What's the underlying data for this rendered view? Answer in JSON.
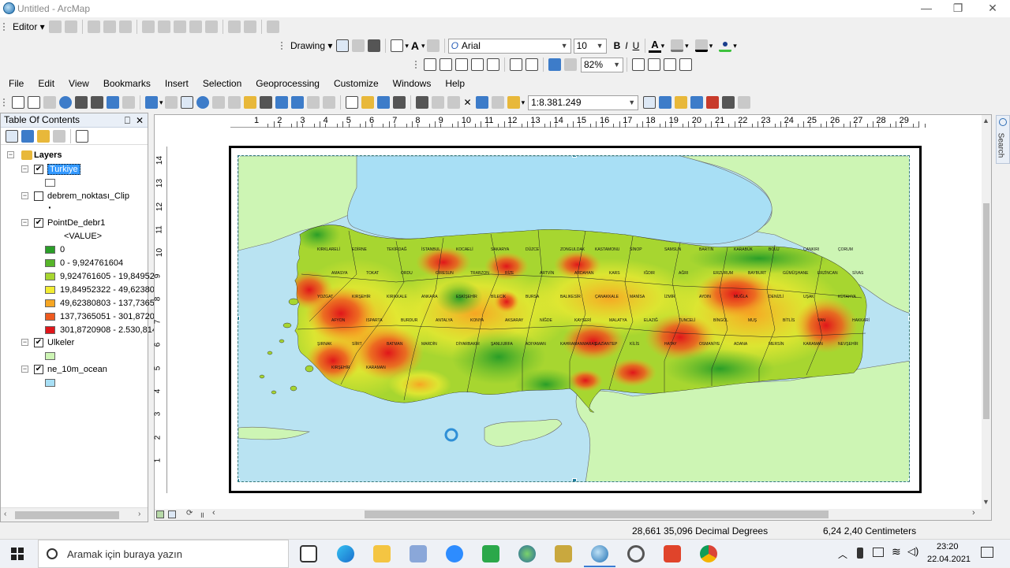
{
  "window": {
    "title": "Untitled - ArcMap",
    "minimize": "—",
    "restore": "❐",
    "close": "✕"
  },
  "editor_toolbar": {
    "label": "Editor ▾"
  },
  "draw_toolbar": {
    "drawing_label": "Drawing ▾",
    "font": "Arial",
    "font_size": "10",
    "bold": "B",
    "italic": "I",
    "underline": "U",
    "font_color_letter": "A",
    "zoom": "82%"
  },
  "menu": [
    "File",
    "Edit",
    "View",
    "Bookmarks",
    "Insert",
    "Selection",
    "Geoprocessing",
    "Customize",
    "Windows",
    "Help"
  ],
  "scale": "1:8.381.249",
  "toc": {
    "title": "Table Of Contents",
    "pin": "⎕",
    "close": "✕",
    "root": "Layers",
    "layers": [
      {
        "name": "Turkiye",
        "checked": true,
        "selected": true
      },
      {
        "name": "debrem_noktası_Clip",
        "checked": false,
        "dot": "·"
      },
      {
        "name": "PointDe_debr1",
        "checked": true,
        "field": "<VALUE>"
      },
      {
        "name": "Ulkeler",
        "checked": true
      },
      {
        "name": "ne_10m_ocean",
        "checked": true
      }
    ],
    "legend": [
      {
        "label": "0",
        "color": "#2a9e28"
      },
      {
        "label": "0 - 9,924761604",
        "color": "#57b52a"
      },
      {
        "label": "9,924761605 - 19,84952",
        "color": "#a7d630"
      },
      {
        "label": "19,84952322 - 49,62380",
        "color": "#f2ec32"
      },
      {
        "label": "49,62380803 - 137,7365",
        "color": "#f6a623"
      },
      {
        "label": "137,7365051 - 301,8720",
        "color": "#ee5a1f"
      },
      {
        "label": "301,8720908 - 2.530,814",
        "color": "#e0161a"
      }
    ],
    "ulkeler_color": "#cdf5b4",
    "ocean_color": "#a8dff5"
  },
  "rulers": {
    "horizontal": [
      "1",
      "2",
      "3",
      "4",
      "5",
      "6",
      "7",
      "8",
      "9",
      "10",
      "11",
      "12",
      "13",
      "14",
      "15",
      "16",
      "17",
      "18",
      "19",
      "20",
      "21",
      "22",
      "23",
      "24",
      "25",
      "26",
      "27",
      "28",
      "29"
    ],
    "vertical": [
      "14",
      "13",
      "12",
      "11",
      "10",
      "9",
      "8",
      "7",
      "6",
      "5",
      "4",
      "3",
      "2",
      "1"
    ]
  },
  "provinces": [
    "KIRKLARELİ",
    "EDİRNE",
    "TEKİRDAĞ",
    "İSTANBUL",
    "KOCAELİ",
    "SAKARYA",
    "DÜZCE",
    "ZONGULDAK",
    "KASTAMONU",
    "SİNOP",
    "SAMSUN",
    "BARTIN",
    "KARABÜK",
    "BOLU",
    "ÇANKIRI",
    "ÇORUM",
    "AMASYA",
    "TOKAT",
    "ORDU",
    "GİRESUN",
    "TRABZON",
    "RİZE",
    "ARTVİN",
    "ARDAHAN",
    "KARS",
    "IĞDIR",
    "AĞRI",
    "ERZURUM",
    "BAYBURT",
    "GÜMÜŞHANE",
    "ERZİNCAN",
    "SİVAS",
    "YOZGAT",
    "KIRŞEHİR",
    "KIRIKKALE",
    "ANKARA",
    "ESKİŞEHİR",
    "BİLECİK",
    "BURSA",
    "BALIKESİR",
    "ÇANAKKALE",
    "MANİSA",
    "İZMİR",
    "AYDIN",
    "MUĞLA",
    "DENİZLİ",
    "UŞAK",
    "KÜTAHYA",
    "AFYON",
    "ISPARTA",
    "BURDUR",
    "ANTALYA",
    "KONYA",
    "AKSARAY",
    "NİĞDE",
    "KAYSERİ",
    "MALATYA",
    "ELAZIĞ",
    "TUNCELİ",
    "BİNGÖL",
    "MUŞ",
    "BİTLİS",
    "VAN",
    "HAKKARİ",
    "ŞIRNAK",
    "SİİRT",
    "BATMAN",
    "MARDİN",
    "DİYARBAKIR",
    "ŞANLIURFA",
    "ADIYAMAN",
    "KAHRAMANMARAŞ",
    "GAZİANTEP",
    "KİLİS",
    "HATAY",
    "OSMANİYE",
    "ADANA",
    "MERSİN",
    "KARAMAN",
    "NEVŞEHİR",
    "KIRŞEHİR",
    "KARAMAN"
  ],
  "status": {
    "coords": "28,661  35,096 Decimal Degrees",
    "page": "6,24  2,40 Centimeters"
  },
  "taskbar": {
    "search_placeholder": "Aramak için buraya yazın",
    "time": "23:20",
    "date": "22.04.2021"
  },
  "side_tab": "Search"
}
